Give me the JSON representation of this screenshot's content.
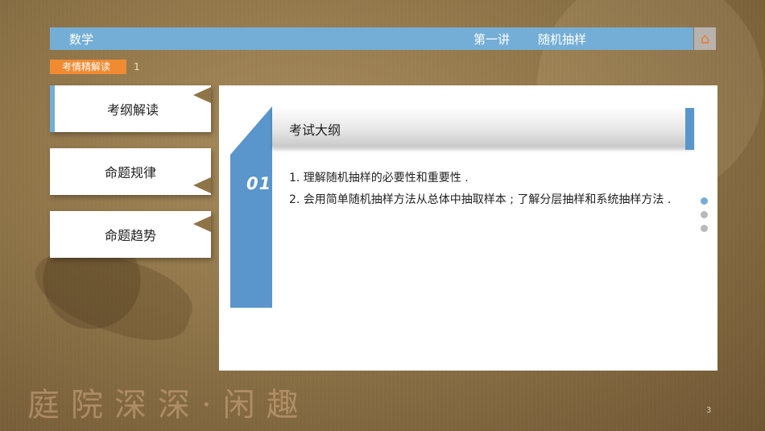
{
  "header": {
    "subject": "数学",
    "lecture": "第一讲",
    "topic": "随机抽样"
  },
  "tag": {
    "label": "考情精解读",
    "number": "1"
  },
  "sidebar": {
    "items": [
      {
        "label": "考纲解读",
        "active": true
      },
      {
        "label": "命题规律",
        "active": false
      },
      {
        "label": "命题趋势",
        "active": false
      }
    ]
  },
  "main": {
    "section_number": "01",
    "section_title": "考试大纲",
    "lines": [
      "1. 理解随机抽样的必要性和重要性 .",
      "2. 会用简单随机抽样方法从总体中抽取样本 ; 了解分层抽样和系统抽样方法 ."
    ]
  },
  "pager": {
    "count": 3,
    "active_index": 0
  },
  "footer": {
    "seal_text": "庭院深深·闲趣",
    "page_number": "3"
  },
  "colors": {
    "header_blue": "#74aed6",
    "ribbon_blue": "#5a95cc",
    "tag_orange": "#f08b32"
  },
  "icons": {
    "home": "home-icon"
  }
}
